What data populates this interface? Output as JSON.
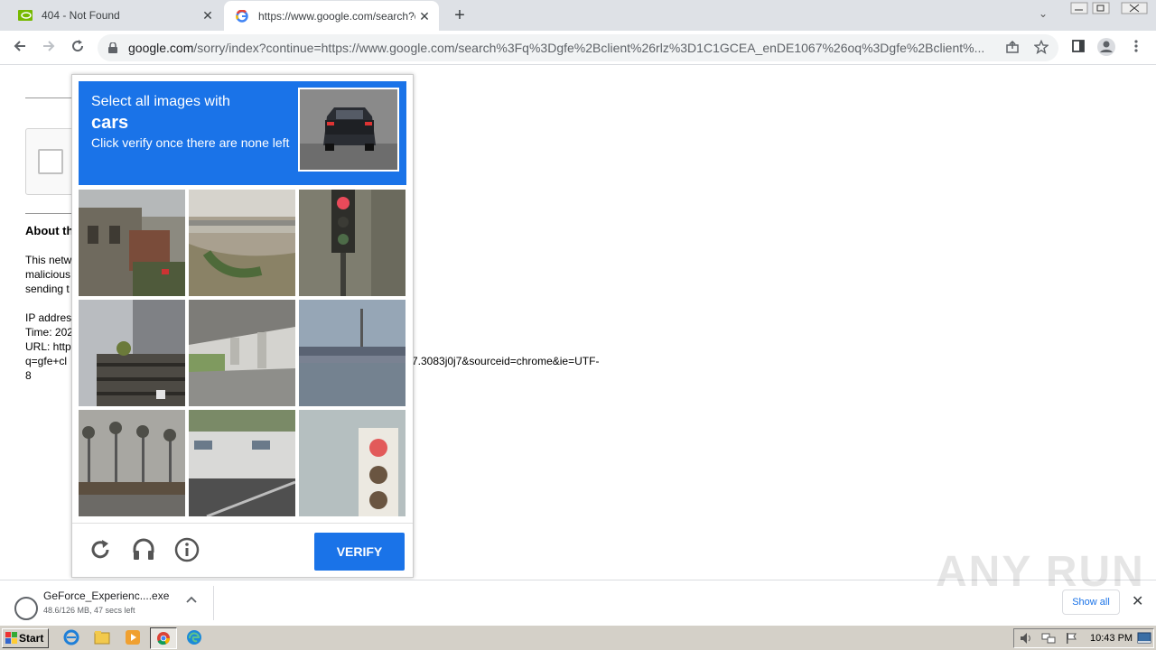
{
  "browser": {
    "tabs": [
      {
        "title": "404 - Not Found",
        "close": "✕"
      },
      {
        "title": "https://www.google.com/search?q=",
        "close": "✕"
      }
    ],
    "new_tab": "+",
    "tab_search": "⌄",
    "address": {
      "host": "google.com",
      "path": "/sorry/index?continue=https://www.google.com/search%3Fq%3Dgfe%2Bclient%26rlz%3D1C1GCEA_enDE1067%26oq%3Dgfe%2Bclient%..."
    }
  },
  "page": {
    "about_heading": "About th",
    "para1": [
      "This netw",
      "malicious",
      "sending t"
    ],
    "para2": [
      "IP addres",
      "Time: 202",
      "URL: http",
      "q=gfe+cl",
      "8"
    ],
    "url_tail": "7.3083j0j7&sourceid=chrome&ie=UTF-"
  },
  "captcha": {
    "line1": "Select all images with",
    "target": "cars",
    "line3": "Click verify once there are none left",
    "verify_label": "VERIFY",
    "tiles": [
      "house",
      "bridge",
      "traffic-light",
      "porch-stairs",
      "overpass",
      "bridge-river",
      "palm-trees",
      "rv-trailer",
      "traffic-light"
    ]
  },
  "downloads": {
    "file_name": "GeForce_Experienc....exe",
    "file_status": "48.6/126 MB, 47 secs left",
    "show_all": "Show all",
    "close": "✕"
  },
  "watermark": "ANY RUN",
  "taskbar": {
    "start_label": "Start",
    "clock": "10:43 PM"
  },
  "colors": {
    "accent": "#1a73e8",
    "tabstrip": "#dee1e6"
  }
}
